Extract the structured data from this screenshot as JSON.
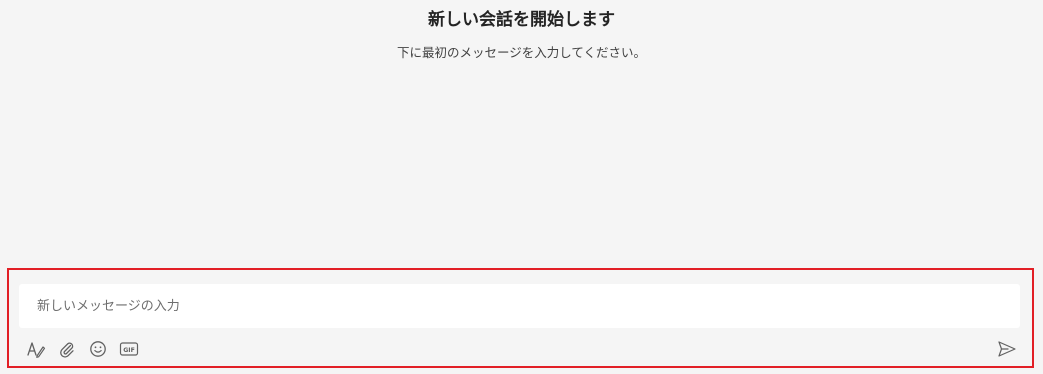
{
  "empty_state": {
    "title": "新しい会話を開始します",
    "subtitle": "下に最初のメッセージを入力してください。"
  },
  "compose": {
    "placeholder": "新しいメッセージの入力",
    "toolbar": {
      "format_icon": "format-icon",
      "attach_icon": "paperclip-icon",
      "emoji_icon": "emoji-icon",
      "gif_icon": "gif-icon",
      "gif_label": "GIF"
    },
    "send_icon": "send-icon"
  },
  "colors": {
    "background": "#f5f5f5",
    "input_background": "#ffffff",
    "highlight_border": "#e21f26",
    "icon": "#616161"
  }
}
